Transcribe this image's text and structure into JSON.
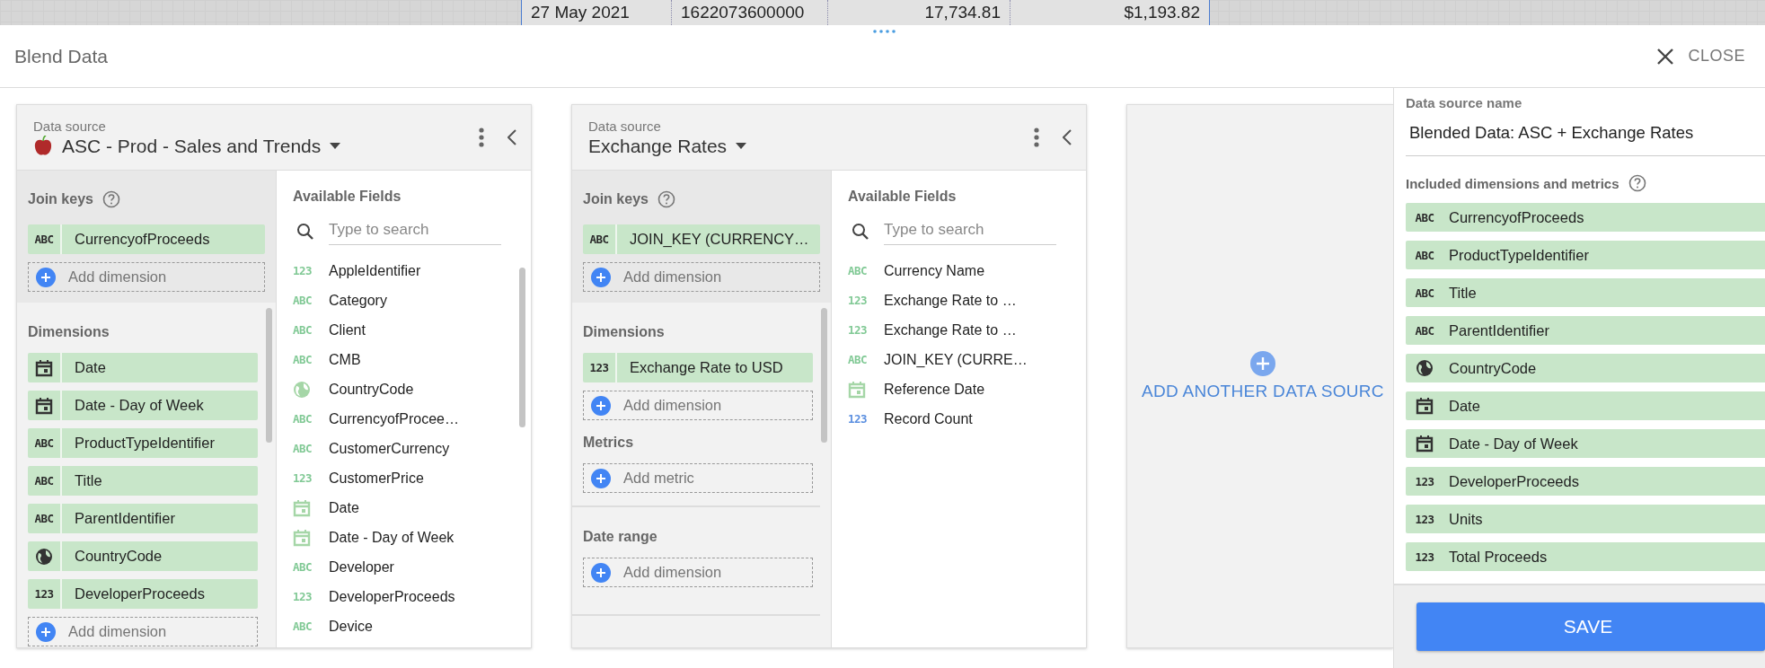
{
  "background_row": {
    "cells": [
      "27 May 2021",
      "1622073600000",
      "17,734.81",
      "$1,193.82"
    ]
  },
  "dialog": {
    "title": "Blend Data",
    "close_label": "CLOSE"
  },
  "sources": [
    {
      "label": "Data source",
      "name": "ASC - Prod - Sales and Trends",
      "logo": true,
      "join_keys": {
        "title": "Join keys",
        "fields": [
          {
            "kind": "text",
            "badge": "ABC",
            "name": "CurrencyofProceeds"
          }
        ],
        "add_label": "Add dimension"
      },
      "sections": [
        {
          "kind": "group",
          "title": "Dimensions",
          "add_label": "Add dimension",
          "fields": [
            {
              "kind": "date",
              "name": "Date"
            },
            {
              "kind": "date",
              "name": "Date - Day of Week"
            },
            {
              "kind": "text",
              "badge": "ABC",
              "name": "ProductTypeIdentifier"
            },
            {
              "kind": "text",
              "badge": "ABC",
              "name": "Title"
            },
            {
              "kind": "text",
              "badge": "ABC",
              "name": "ParentIdentifier"
            },
            {
              "kind": "geo",
              "name": "CountryCode"
            },
            {
              "kind": "number",
              "badge": "123",
              "name": "DeveloperProceeds"
            }
          ]
        }
      ],
      "available": {
        "title": "Available Fields",
        "placeholder": "Type to search",
        "fields": [
          {
            "kind": "number",
            "badge": "123",
            "name": "AppleIdentifier"
          },
          {
            "kind": "text",
            "badge": "ABC",
            "name": "Category"
          },
          {
            "kind": "text",
            "badge": "ABC",
            "name": "Client"
          },
          {
            "kind": "text",
            "badge": "ABC",
            "name": "CMB"
          },
          {
            "kind": "geo",
            "name": "CountryCode"
          },
          {
            "kind": "text",
            "badge": "ABC",
            "name": "CurrencyofProcee…"
          },
          {
            "kind": "text",
            "badge": "ABC",
            "name": "CustomerCurrency"
          },
          {
            "kind": "number",
            "badge": "123",
            "name": "CustomerPrice"
          },
          {
            "kind": "date",
            "name": "Date"
          },
          {
            "kind": "date",
            "name": "Date - Day of Week"
          },
          {
            "kind": "text",
            "badge": "ABC",
            "name": "Developer"
          },
          {
            "kind": "number",
            "badge": "123",
            "name": "DeveloperProceeds"
          },
          {
            "kind": "text",
            "badge": "ABC",
            "name": "Device"
          }
        ]
      }
    },
    {
      "label": "Data source",
      "name": "Exchange Rates",
      "logo": false,
      "join_keys": {
        "title": "Join keys",
        "fields": [
          {
            "kind": "text",
            "badge": "ABC",
            "name": "JOIN_KEY (CURRENCY…"
          }
        ],
        "add_label": "Add dimension"
      },
      "sections": [
        {
          "kind": "group",
          "title": "Dimensions",
          "add_label": "Add dimension",
          "fields": [
            {
              "kind": "number",
              "badge": "123",
              "name": "Exchange Rate to USD"
            }
          ]
        },
        {
          "kind": "group",
          "title": "Metrics",
          "add_label": "Add metric"
        },
        {
          "kind": "divider"
        },
        {
          "kind": "group",
          "title": "Date range",
          "add_label": "Add dimension"
        },
        {
          "kind": "divider"
        }
      ],
      "available": {
        "title": "Available Fields",
        "placeholder": "Type to search",
        "fields": [
          {
            "kind": "text",
            "badge": "ABC",
            "name": "Currency Name"
          },
          {
            "kind": "number",
            "badge": "123",
            "name": "Exchange Rate to …"
          },
          {
            "kind": "number",
            "badge": "123",
            "name": "Exchange Rate to …"
          },
          {
            "kind": "text",
            "badge": "ABC",
            "name": "JOIN_KEY (CURRE…"
          },
          {
            "kind": "date",
            "name": "Reference Date"
          },
          {
            "kind": "metric",
            "badge": "123",
            "name": "Record Count"
          }
        ]
      }
    }
  ],
  "add_source_label": "ADD ANOTHER DATA SOURC",
  "blend_panel": {
    "name_label": "Data source name",
    "name_value": "Blended Data: ASC + Exchange Rates",
    "included_title": "Included dimensions and metrics",
    "fields": [
      {
        "kind": "text",
        "badge": "ABC",
        "name": "CurrencyofProceeds"
      },
      {
        "kind": "text",
        "badge": "ABC",
        "name": "ProductTypeIdentifier"
      },
      {
        "kind": "text",
        "badge": "ABC",
        "name": "Title"
      },
      {
        "kind": "text",
        "badge": "ABC",
        "name": "ParentIdentifier"
      },
      {
        "kind": "geo",
        "name": "CountryCode"
      },
      {
        "kind": "date",
        "name": "Date"
      },
      {
        "kind": "date",
        "name": "Date - Day of Week"
      },
      {
        "kind": "number",
        "badge": "123",
        "name": "DeveloperProceeds"
      },
      {
        "kind": "number",
        "badge": "123",
        "name": "Units"
      },
      {
        "kind": "number",
        "badge": "123",
        "name": "Total Proceeds"
      }
    ],
    "save_label": "SAVE"
  }
}
